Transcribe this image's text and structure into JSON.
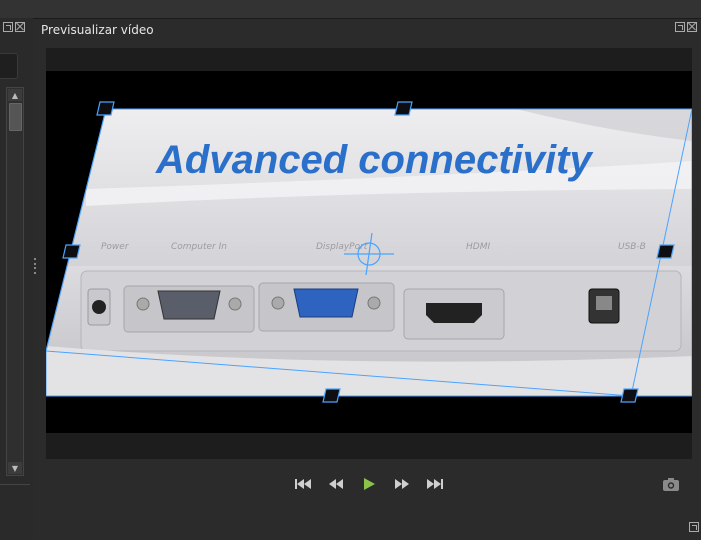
{
  "panel": {
    "title": "Previsualizar vídeo"
  },
  "video": {
    "overlay_text": "Advanced connectivity",
    "port_labels": [
      "Power",
      "Computer In",
      "DisplayPort",
      "HDMI",
      "USB-B"
    ]
  },
  "playback_controls": [
    {
      "name": "skip-to-start-button",
      "icon": "skip-back-icon"
    },
    {
      "name": "rewind-button",
      "icon": "rewind-icon"
    },
    {
      "name": "play-button",
      "icon": "play-icon"
    },
    {
      "name": "fast-forward-button",
      "icon": "fast-forward-icon"
    },
    {
      "name": "skip-to-end-button",
      "icon": "skip-forward-icon"
    }
  ],
  "colors": {
    "accent_play": "#8bc34a",
    "selection_handle": "#4aa3ff",
    "title_blue": "#2a6fc9"
  }
}
